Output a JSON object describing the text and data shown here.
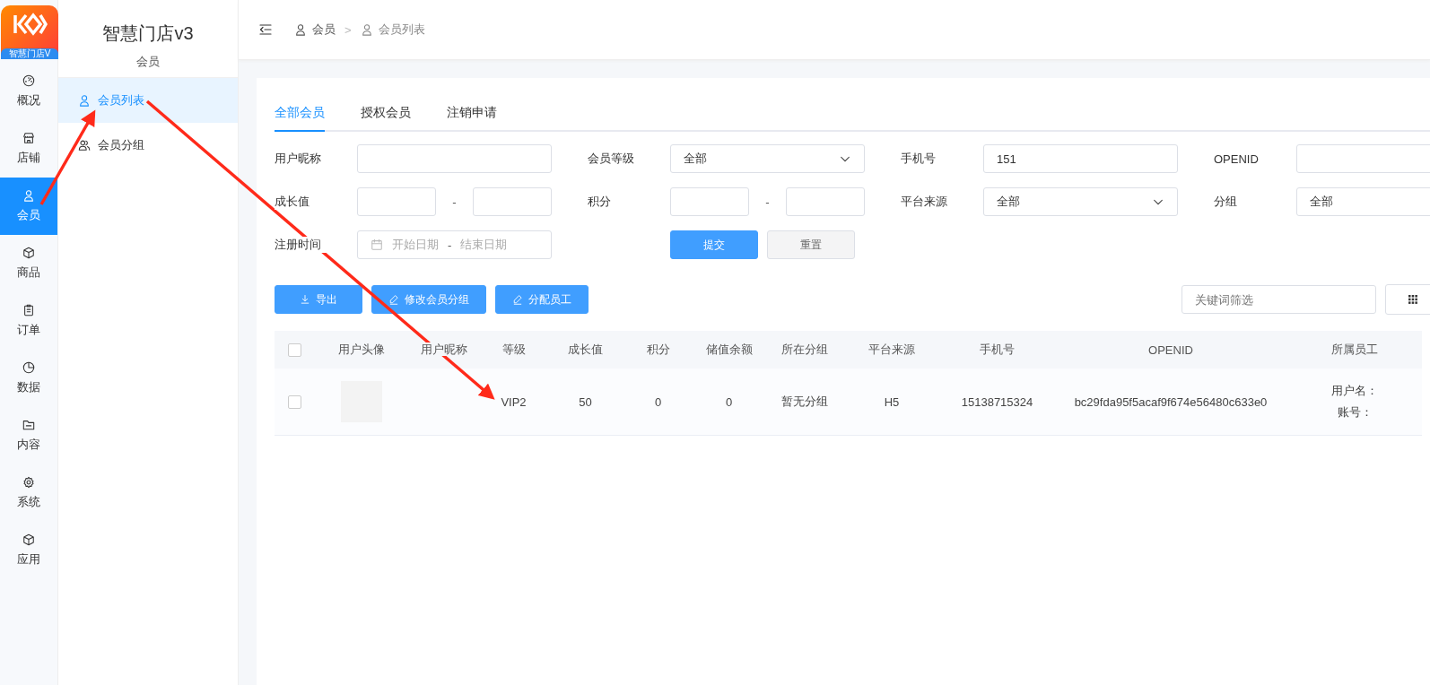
{
  "logo": {
    "text": "智慧门店V"
  },
  "rail": [
    {
      "label": "概况",
      "selected": false
    },
    {
      "label": "店铺",
      "selected": false
    },
    {
      "label": "会员",
      "selected": true
    },
    {
      "label": "商品",
      "selected": false
    },
    {
      "label": "订单",
      "selected": false
    },
    {
      "label": "数据",
      "selected": false
    },
    {
      "label": "内容",
      "selected": false
    },
    {
      "label": "系统",
      "selected": false
    },
    {
      "label": "应用",
      "selected": false
    }
  ],
  "sidebar": {
    "title": "智慧门店v3",
    "subtitle": "会员",
    "items": [
      {
        "label": "会员列表",
        "selected": true
      },
      {
        "label": "会员分组",
        "selected": false
      }
    ]
  },
  "breadcrumb": {
    "items": [
      "会员",
      "会员列表"
    ],
    "separator": ">"
  },
  "tabs": [
    {
      "label": "全部会员",
      "selected": true
    },
    {
      "label": "授权会员",
      "selected": false
    },
    {
      "label": "注销申请",
      "selected": false
    }
  ],
  "filters": [
    {
      "kind": "text",
      "label": "用户昵称"
    },
    {
      "kind": "select",
      "label": "会员等级",
      "value": "全部",
      "caret": true
    },
    {
      "kind": "text",
      "label": "手机号",
      "value": "151"
    },
    {
      "kind": "text",
      "label": "OPENID"
    },
    {
      "kind": "range",
      "label": "成长值",
      "separator": "-"
    },
    {
      "kind": "range",
      "label": "积分",
      "separator": "-"
    },
    {
      "kind": "select",
      "label": "平台来源",
      "value": "全部",
      "caret": true
    },
    {
      "kind": "select",
      "label": "分组",
      "value": "全部"
    },
    {
      "kind": "daterange",
      "label": "注册时间",
      "start_placeholder": "开始日期",
      "separator": "-",
      "end_placeholder": "结束日期"
    }
  ],
  "form_buttons": [
    {
      "label": "提交",
      "kind": "primary"
    },
    {
      "label": "重置",
      "kind": "default"
    }
  ],
  "actions": [
    {
      "label": "导出"
    },
    {
      "label": "修改会员分组"
    },
    {
      "label": "分配员工"
    }
  ],
  "search": {
    "placeholder": "关键词筛选"
  },
  "table": {
    "header_checked": false,
    "columns": [
      "用户头像",
      "用户昵称",
      "等级",
      "成长值",
      "积分",
      "储值余额",
      "所在分组",
      "平台来源",
      "手机号",
      "OPENID",
      "所属员工"
    ],
    "rows": [
      {
        "checked": false,
        "level_name": "VIP2",
        "growth": "50",
        "points": "0",
        "balance": "0",
        "group": "暂无分组",
        "source": "H5",
        "phone": "15138715324",
        "openid": "bc29fda95f5acaf9f674e56480c633e0",
        "staff": [
          "用户名：",
          "账号："
        ]
      }
    ]
  }
}
